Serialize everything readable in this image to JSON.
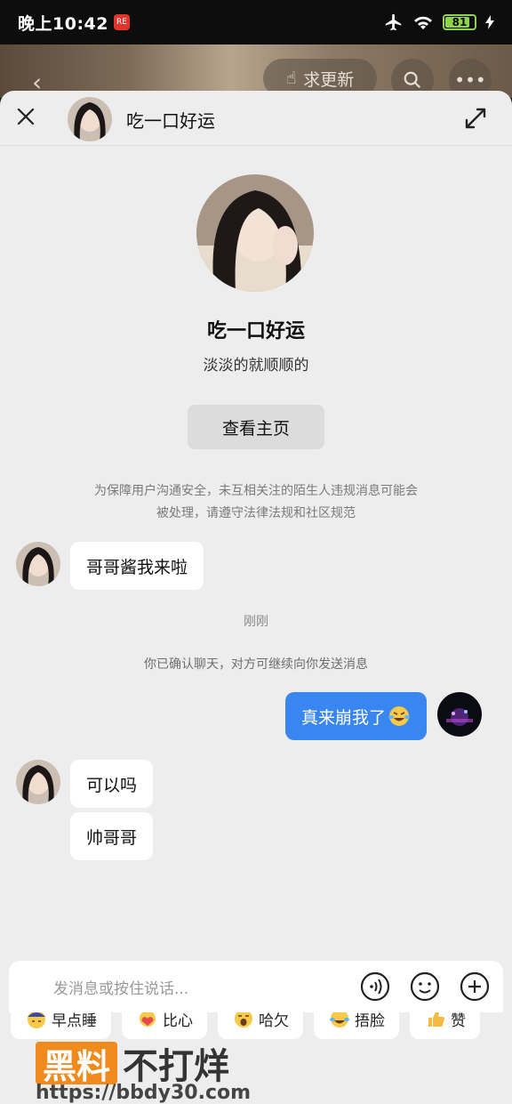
{
  "status_bar": {
    "time": "晚上10:42",
    "app_badge": "RE",
    "battery": "81"
  },
  "background": {
    "refresh_label": "求更新"
  },
  "header": {
    "name": "吃一口好运"
  },
  "profile": {
    "name": "吃一口好运",
    "bio": "淡淡的就顺顺的",
    "view_home_label": "查看主页"
  },
  "notice": {
    "line1": "为保障用户沟通安全，未互相关注的陌生人违规消息可能会",
    "line2": "被处理，请遵守法律法规和社区规范"
  },
  "messages": [
    {
      "from": "other",
      "text": "哥哥酱我来啦"
    },
    {
      "from": "me",
      "text": "真来崩我了"
    },
    {
      "from": "other",
      "text": "可以吗"
    },
    {
      "from": "other",
      "text": "帅哥哥"
    }
  ],
  "time_label": "刚刚",
  "system_msg": "你已确认聊天，对方可继续向你发送消息",
  "quick_replies": [
    {
      "label": "早点睡",
      "icon": "sleep-emoji"
    },
    {
      "label": "比心",
      "icon": "heart-hands-emoji"
    },
    {
      "label": "哈欠",
      "icon": "yawn-emoji"
    },
    {
      "label": "捂脸",
      "icon": "facepalm-emoji"
    },
    {
      "label": "赞",
      "icon": "thumbs-up-emoji"
    }
  ],
  "input": {
    "placeholder": "发消息或按住说话..."
  },
  "watermark": {
    "box": "黑料",
    "text": "不打烊",
    "url": "https://bbdy30.com"
  },
  "colors": {
    "accent": "#3a86f0",
    "sheet_bg": "#ededed",
    "bubble": "#ffffff"
  }
}
